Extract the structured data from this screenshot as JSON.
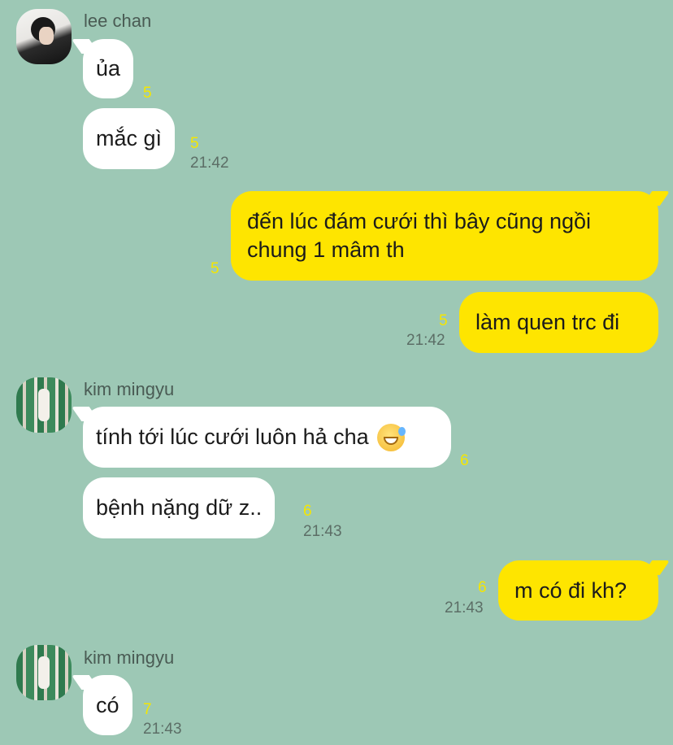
{
  "messages": [
    {
      "sender": "lee chan",
      "text": "ủa",
      "count": "5"
    },
    {
      "text": "mắc gì",
      "count": "5",
      "time": "21:42"
    },
    {
      "text_line1": "đến lúc đám cưới thì bây cũng ngồi",
      "text_line2": "chung 1 mâm th",
      "count": "5"
    },
    {
      "text": "làm quen trc đi",
      "count": "5",
      "time": "21:42"
    },
    {
      "sender": "kim mingyu",
      "text": "tính tới lúc cưới luôn hả cha",
      "count": "6"
    },
    {
      "text": "bệnh nặng dữ z..",
      "count": "6",
      "time": "21:43"
    },
    {
      "text": "m có đi kh?",
      "count": "6",
      "time": "21:43"
    },
    {
      "sender": "kim mingyu",
      "text": "có",
      "count": "7",
      "time": "21:43"
    }
  ],
  "colors": {
    "background": "#9DC8B5",
    "outgoing_bubble": "#FEE500",
    "incoming_bubble": "#FFFFFF",
    "unread_count": "#F5E600"
  },
  "icons": [
    "avatar-lee-chan",
    "avatar-kim-mingyu",
    "sweat-smile-emoji"
  ]
}
